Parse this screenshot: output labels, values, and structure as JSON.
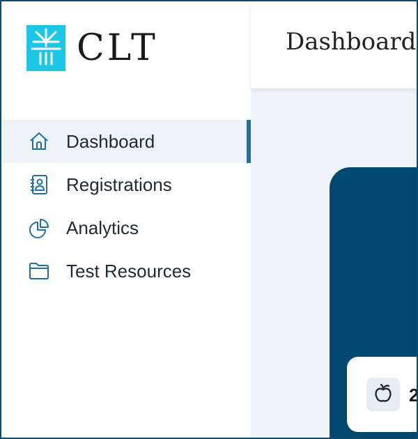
{
  "brand": {
    "name": "CLT",
    "logo_icon": "clt-logo-icon",
    "logo_color": "#1cc6e6"
  },
  "header": {
    "title": "Dashboard"
  },
  "sidebar": {
    "items": [
      {
        "label": "Dashboard",
        "icon": "home-icon",
        "active": true
      },
      {
        "label": "Registrations",
        "icon": "contact-book-icon",
        "active": false
      },
      {
        "label": "Analytics",
        "icon": "pie-chart-icon",
        "active": false
      },
      {
        "label": "Test Resources",
        "icon": "folder-icon",
        "active": false
      }
    ]
  },
  "main": {
    "card": {
      "icon": "apple-icon",
      "text_partial": "2"
    }
  },
  "colors": {
    "accent": "#1f6f9f",
    "hero_bg": "#004a72",
    "main_bg": "#eef2f6"
  }
}
